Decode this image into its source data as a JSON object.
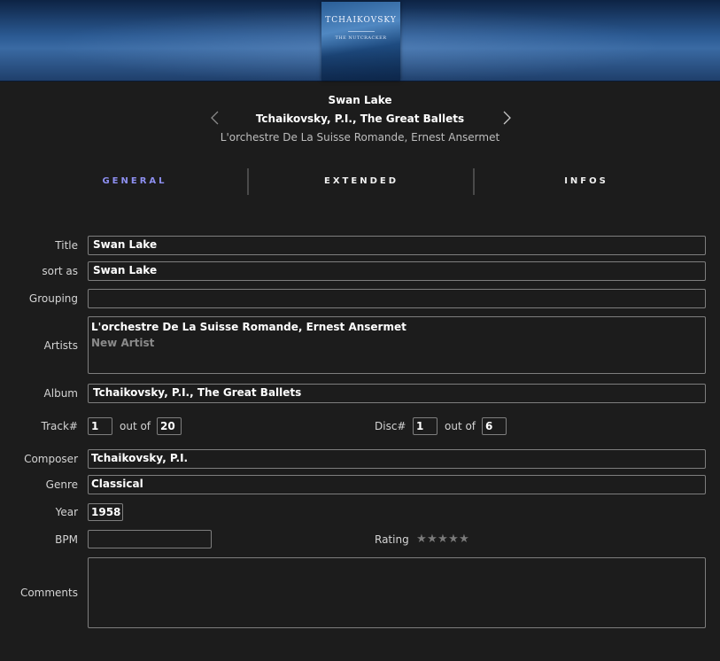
{
  "cover": {
    "title": "TCHAIKOVSKY",
    "subtitle": "THE NUTCRACKER"
  },
  "header": {
    "title": "Swan Lake",
    "album": "Tchaikovsky, P.I., The Great Ballets",
    "artist": "L'orchestre De La Suisse Romande, Ernest Ansermet"
  },
  "tabs": [
    {
      "label": "GENERAL",
      "active": true
    },
    {
      "label": "EXTENDED",
      "active": false
    },
    {
      "label": "INFOS",
      "active": false
    }
  ],
  "form": {
    "title": {
      "label": "Title",
      "value": "Swan Lake"
    },
    "sort_as": {
      "label": "sort as",
      "value": "Swan Lake"
    },
    "grouping": {
      "label": "Grouping",
      "value": ""
    },
    "artists": {
      "label": "Artists",
      "values": [
        "L'orchestre De La Suisse Romande, Ernest Ansermet"
      ],
      "placeholder": "New Artist"
    },
    "album": {
      "label": "Album",
      "value": "Tchaikovsky, P.I., The Great Ballets"
    },
    "track": {
      "label": "Track#",
      "value": "1",
      "out_of_label": "out of",
      "total": "20"
    },
    "disc": {
      "label": "Disc#",
      "value": "1",
      "out_of_label": "out of",
      "total": "6"
    },
    "composer": {
      "label": "Composer",
      "value": "Tchaikovsky, P.I."
    },
    "genre": {
      "label": "Genre",
      "value": "Classical"
    },
    "year": {
      "label": "Year",
      "value": "1958"
    },
    "bpm": {
      "label": "BPM",
      "value": ""
    },
    "rating": {
      "label": "Rating",
      "stars_filled": 0,
      "stars_total": 5
    },
    "comments": {
      "label": "Comments",
      "value": ""
    }
  },
  "colors": {
    "background": "#1c1c1c",
    "active_tab": "#8d8ff0",
    "field_border": "#7e7e7e"
  },
  "icons": [
    "chevron-left-icon",
    "chevron-right-icon",
    "star-icon"
  ]
}
